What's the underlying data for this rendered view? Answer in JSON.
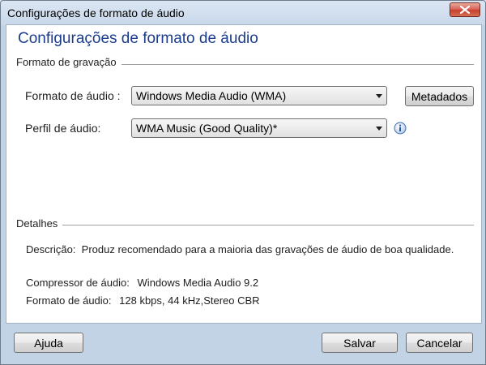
{
  "window": {
    "title": "Configurações de formato de áudio"
  },
  "header": {
    "title": "Configurações de formato de áudio"
  },
  "recording_group": {
    "label": "Formato de gravação",
    "audio_format": {
      "label": "Formato de áudio :",
      "value": "Windows Media Audio (WMA)"
    },
    "audio_profile": {
      "label": "Perfil de áudio:",
      "value": "WMA Music (Good Quality)*"
    },
    "metadata_button": "Metadados"
  },
  "details_group": {
    "label": "Detalhes",
    "description": {
      "label": "Descrição:",
      "value": "Produz recomendado para a maioria das gravações de áudio de boa qualidade."
    },
    "compressor": {
      "label": "Compressor de áudio:",
      "value": "Windows Media Audio 9.2"
    },
    "format": {
      "label": "Formato de áudio:",
      "value": "128 kbps, 44 kHz,Stereo CBR"
    }
  },
  "footer": {
    "help_button": "Ajuda",
    "save_button": "Salvar",
    "cancel_button": "Cancelar"
  },
  "icons": {
    "close": "close-icon",
    "info": "info-icon"
  },
  "colors": {
    "header_text": "#1c3c8c",
    "frame": "#c3d3e6",
    "close_button": "#c8402e"
  }
}
